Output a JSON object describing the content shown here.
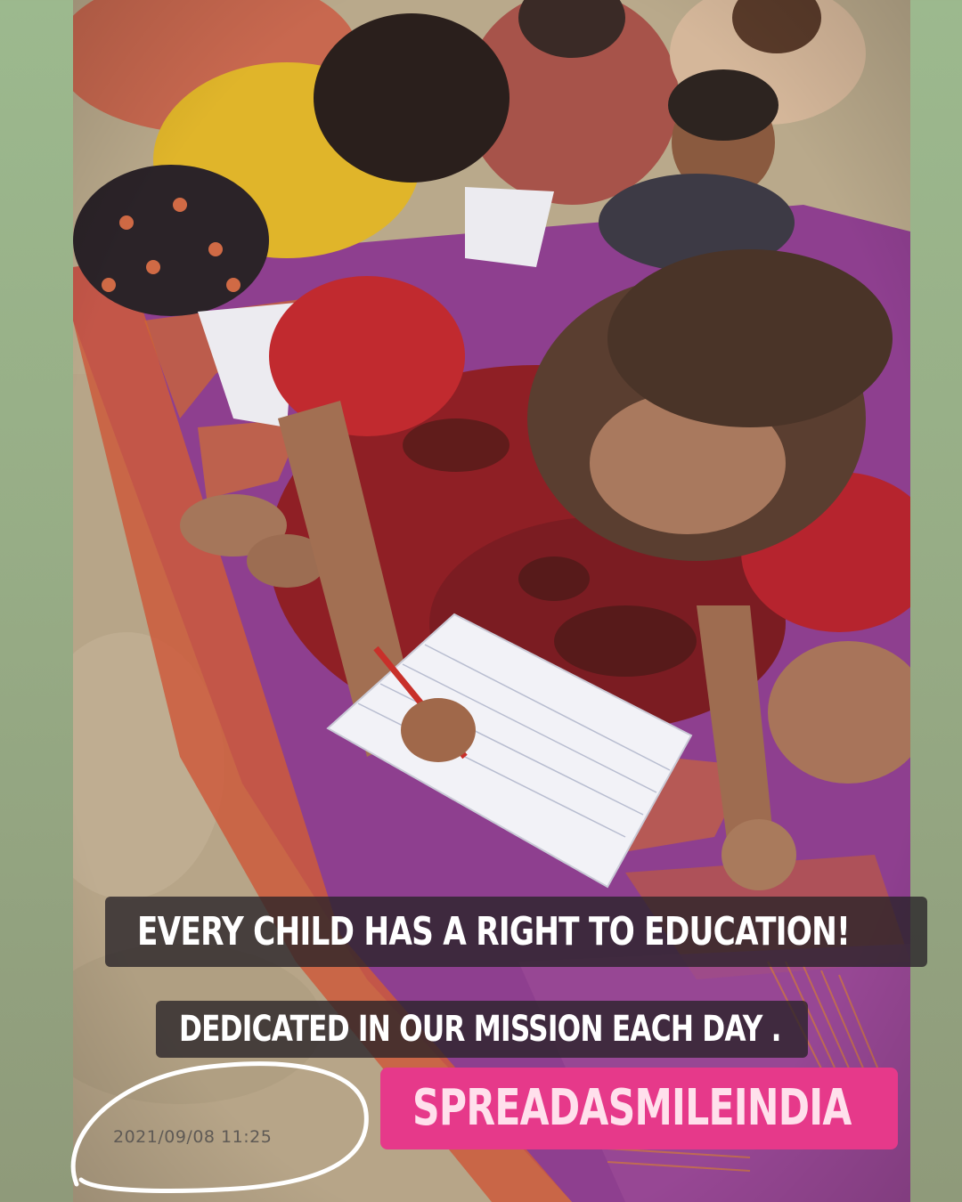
{
  "story": {
    "headline": "EVERY CHILD HAS A RIGHT TO  EDUCATION!",
    "subline": "DEDICATED IN OUR MISSION EACH DAY .",
    "hashtag": "SPREADASMILEINDIA",
    "timestamp": "2021/09/08 11:25"
  },
  "colors": {
    "frame_background": "#9cb98e",
    "caption_background": "#2a2328",
    "hashtag_background": "#e6398a",
    "caption_text": "#ffffff",
    "hashtag_text": "#ffe0ec",
    "circle_annotation": "#ffffff"
  }
}
